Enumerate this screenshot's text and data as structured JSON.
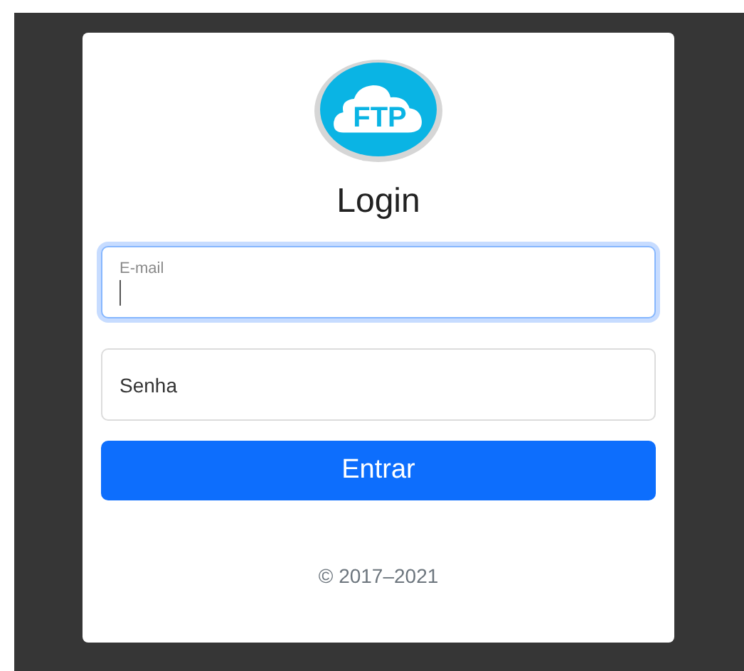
{
  "logo": {
    "text": "FTP"
  },
  "title": "Login",
  "fields": [
    {
      "label": "E-mail",
      "focused": true
    },
    {
      "label": "Senha",
      "focused": false
    }
  ],
  "submit": "Entrar",
  "footer": "© 2017–2021"
}
